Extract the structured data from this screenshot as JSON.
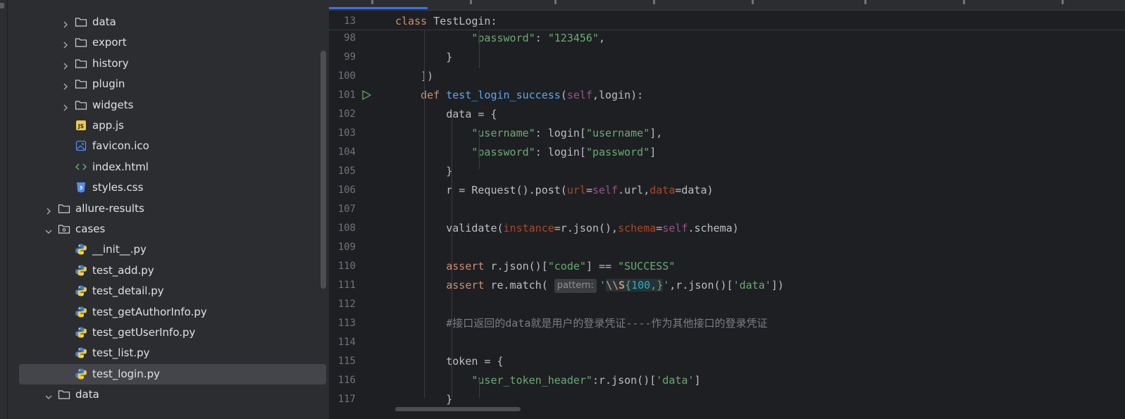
{
  "project_tree": {
    "items": [
      {
        "name": "data",
        "type": "folder",
        "expanded": false,
        "depth": 2
      },
      {
        "name": "export",
        "type": "folder",
        "expanded": false,
        "depth": 2
      },
      {
        "name": "history",
        "type": "folder",
        "expanded": false,
        "depth": 2
      },
      {
        "name": "plugin",
        "type": "folder",
        "expanded": false,
        "depth": 2
      },
      {
        "name": "widgets",
        "type": "folder",
        "expanded": false,
        "depth": 2
      },
      {
        "name": "app.js",
        "type": "js-file",
        "depth": 2
      },
      {
        "name": "favicon.ico",
        "type": "image-file",
        "depth": 2
      },
      {
        "name": "index.html",
        "type": "html-file",
        "depth": 2
      },
      {
        "name": "styles.css",
        "type": "css-file",
        "depth": 2
      },
      {
        "name": "allure-results",
        "type": "folder",
        "expanded": false,
        "depth": 1
      },
      {
        "name": "cases",
        "type": "package-folder",
        "expanded": true,
        "depth": 1
      },
      {
        "name": "__init__.py",
        "type": "python-file",
        "depth": 2
      },
      {
        "name": "test_add.py",
        "type": "python-file",
        "depth": 2
      },
      {
        "name": "test_detail.py",
        "type": "python-file",
        "depth": 2
      },
      {
        "name": "test_getAuthorInfo.py",
        "type": "python-file",
        "depth": 2
      },
      {
        "name": "test_getUserInfo.py",
        "type": "python-file",
        "depth": 2
      },
      {
        "name": "test_list.py",
        "type": "python-file",
        "depth": 2
      },
      {
        "name": "test_login.py",
        "type": "python-file",
        "depth": 2,
        "selected": true
      },
      {
        "name": "data",
        "type": "folder",
        "expanded": true,
        "depth": 1
      }
    ]
  },
  "editor": {
    "sticky_line": {
      "number": "13",
      "text": "class TestLogin:"
    },
    "lines": [
      {
        "number": "98",
        "code": "        \"password\": \"123456\","
      },
      {
        "number": "99",
        "code": "    }"
      },
      {
        "number": "100",
        "code": "])"
      },
      {
        "number": "101",
        "code": "def test_login_success(self,login):",
        "run_gutter_icon": true
      },
      {
        "number": "102",
        "code": "    data = {"
      },
      {
        "number": "103",
        "code": "        \"username\": login[\"username\"],"
      },
      {
        "number": "104",
        "code": "        \"password\": login[\"password\"]"
      },
      {
        "number": "105",
        "code": "    }"
      },
      {
        "number": "106",
        "code": "    r = Request().post(url=self.url,data=data)"
      },
      {
        "number": "107",
        "code": ""
      },
      {
        "number": "108",
        "code": "    validate(instance=r.json(),schema=self.schema)"
      },
      {
        "number": "109",
        "code": ""
      },
      {
        "number": "110",
        "code": "    assert r.json()[\"code\"] == \"SUCCESS\""
      },
      {
        "number": "111",
        "code": "    assert re.match( pattern: '\\\\S{100,}',r.json()['data'])",
        "inlay_hint": "pattern:"
      },
      {
        "number": "112",
        "code": ""
      },
      {
        "number": "113",
        "code": "    #接口返回的data就是用户的登录凭证----作为其他接口的登录凭证"
      },
      {
        "number": "114",
        "code": ""
      },
      {
        "number": "115",
        "code": "    token = {"
      },
      {
        "number": "116",
        "code": "        \"user_token_header\":r.json()['data']"
      },
      {
        "number": "117",
        "code": "    }"
      }
    ]
  },
  "colors": {
    "keyword": "#cf8e6d",
    "string": "#6aab73",
    "function": "#56a8f5",
    "self": "#94558d",
    "named_param": "#aa4926",
    "number": "#2aacb8",
    "comment": "#7a7e85",
    "selection": "#43454a",
    "active_tab": "#3574f0"
  }
}
